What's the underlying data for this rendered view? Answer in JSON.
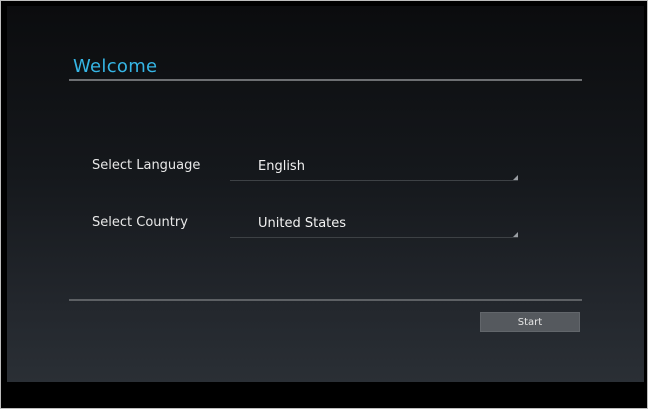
{
  "header": {
    "title": "Welcome"
  },
  "form": {
    "language": {
      "label": "Select Language",
      "value": "English"
    },
    "country": {
      "label": "Select Country",
      "value": "United States"
    }
  },
  "actions": {
    "start_label": "Start"
  },
  "icons": {
    "spinner_caret": "dropdown-corner-icon"
  },
  "colors": {
    "accent": "#35b5e5",
    "button": "#55595e"
  }
}
